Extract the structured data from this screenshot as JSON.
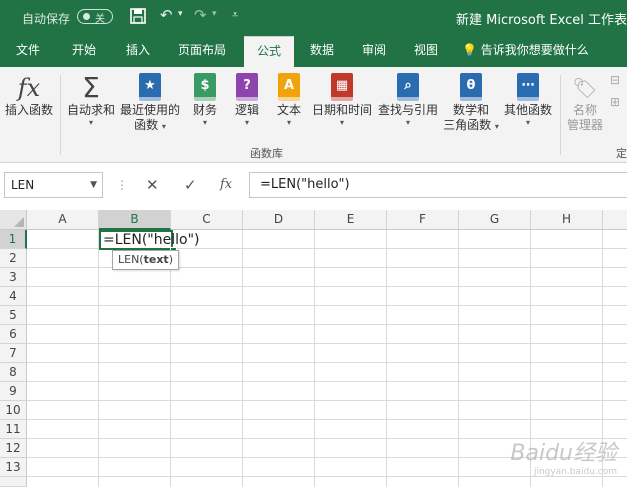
{
  "titlebar": {
    "autosave_label": "自动保存",
    "autosave_state": "关",
    "save_icon": "save-icon",
    "undo_icon": "undo-icon",
    "redo_icon": "redo-icon",
    "customize_icon": "customize-qat-icon",
    "doc_title": "新建 Microsoft Excel 工作表"
  },
  "tabs": [
    "文件",
    "开始",
    "插入",
    "页面布局",
    "公式",
    "数据",
    "审阅",
    "视图"
  ],
  "active_tab": "公式",
  "tell_me": "告诉我你想要做什么",
  "ribbon": {
    "insert_function": "插入函数",
    "autosum": "自动求和",
    "recent_line1": "最近使用的",
    "recent_line2": "函数",
    "financial": "财务",
    "logical": "逻辑",
    "text": "文本",
    "datetime": "日期和时间",
    "lookup": "查找与引用",
    "math_line1": "数学和",
    "math_line2": "三角函数",
    "more": "其他函数",
    "name_mgr_line1": "名称",
    "name_mgr_line2": "管理器",
    "define_partial": "定",
    "group_label": "函数库",
    "colors": {
      "financial": "#2e8b57",
      "logical": "#8e44ad",
      "text": "#f0a30a",
      "datetime": "#c0392b",
      "lookup": "#2b6cb0",
      "math": "#2b6cb0",
      "more": "#2b6cb0",
      "recent": "#2b6cb0"
    }
  },
  "formula_bar": {
    "name_box": "LEN",
    "cancel_icon": "✕",
    "enter_icon": "✓",
    "fx_icon": "fx",
    "formula": "=LEN(\"hello\")"
  },
  "sheet": {
    "columns": [
      "A",
      "B",
      "C",
      "D",
      "E",
      "F",
      "G",
      "H"
    ],
    "selected_column": "B",
    "rows": [
      "1",
      "2",
      "3",
      "4",
      "5",
      "6",
      "7",
      "8",
      "9",
      "10",
      "11",
      "12",
      "13"
    ],
    "selected_row": "1",
    "active_cell_text": "=LEN(\"hello\")",
    "tooltip_func": "LEN(",
    "tooltip_arg": "text",
    "tooltip_close": ")"
  },
  "watermark": {
    "brand": "Baidu经验",
    "url": "jingyan.baidu.com"
  }
}
